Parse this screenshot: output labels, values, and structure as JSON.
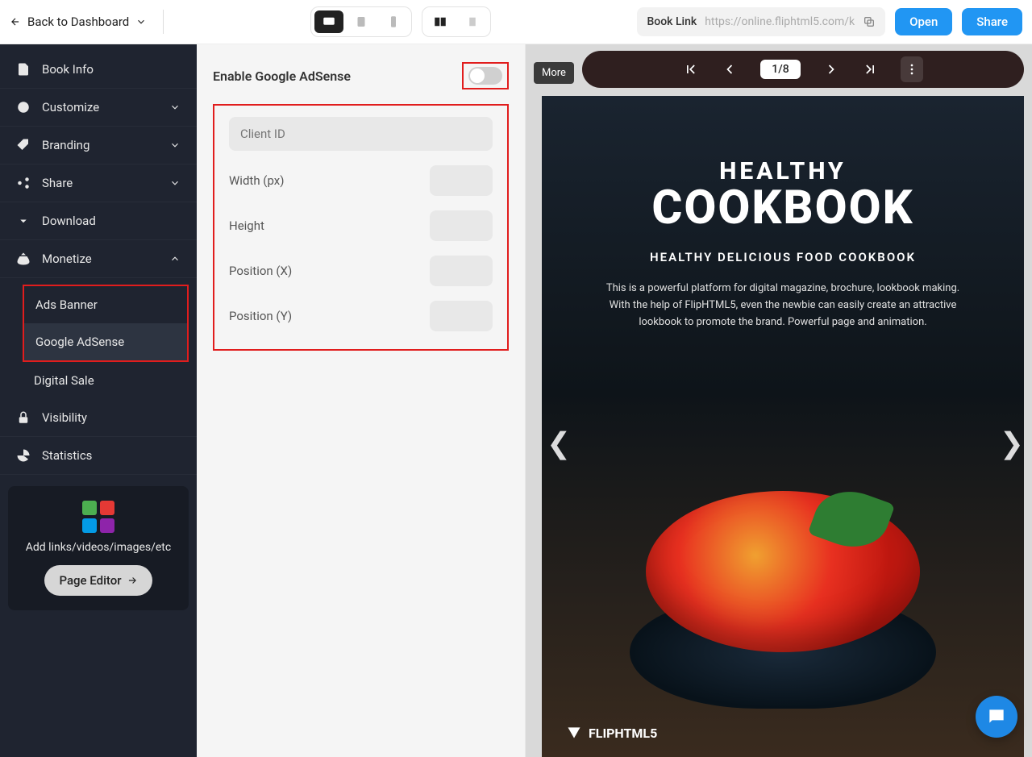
{
  "topbar": {
    "back_label": "Back to Dashboard",
    "booklink_label": "Book Link",
    "booklink_url": "https://online.fliphtml5.com/k",
    "open_label": "Open",
    "share_label": "Share"
  },
  "sidebar": {
    "items": [
      {
        "label": "Book Info"
      },
      {
        "label": "Customize"
      },
      {
        "label": "Branding"
      },
      {
        "label": "Share"
      },
      {
        "label": "Download"
      },
      {
        "label": "Monetize"
      },
      {
        "label": "Ads Banner"
      },
      {
        "label": "Google AdSense"
      },
      {
        "label": "Digital Sale"
      },
      {
        "label": "Visibility"
      },
      {
        "label": "Statistics"
      }
    ],
    "promo_text": "Add links/videos/images/etc",
    "page_editor_label": "Page Editor"
  },
  "config": {
    "enable_label": "Enable Google AdSense",
    "client_id_placeholder": "Client ID",
    "width_label": "Width (px)",
    "height_label": "Height",
    "posx_label": "Position (X)",
    "posy_label": "Position (Y)"
  },
  "preview": {
    "more_label": "More",
    "page_indicator": "1/8",
    "book": {
      "title_small": "HEALTHY",
      "title_big": "COOKBOOK",
      "subtitle": "HEALTHY DELICIOUS FOOD COOKBOOK",
      "description": "This is a powerful platform for digital magazine, brochure, lookbook making. With the help of FlipHTML5, even the newbie can easily create an attractive lookbook to promote the brand. Powerful page and animation.",
      "brand": "FLIPHTML5"
    }
  }
}
